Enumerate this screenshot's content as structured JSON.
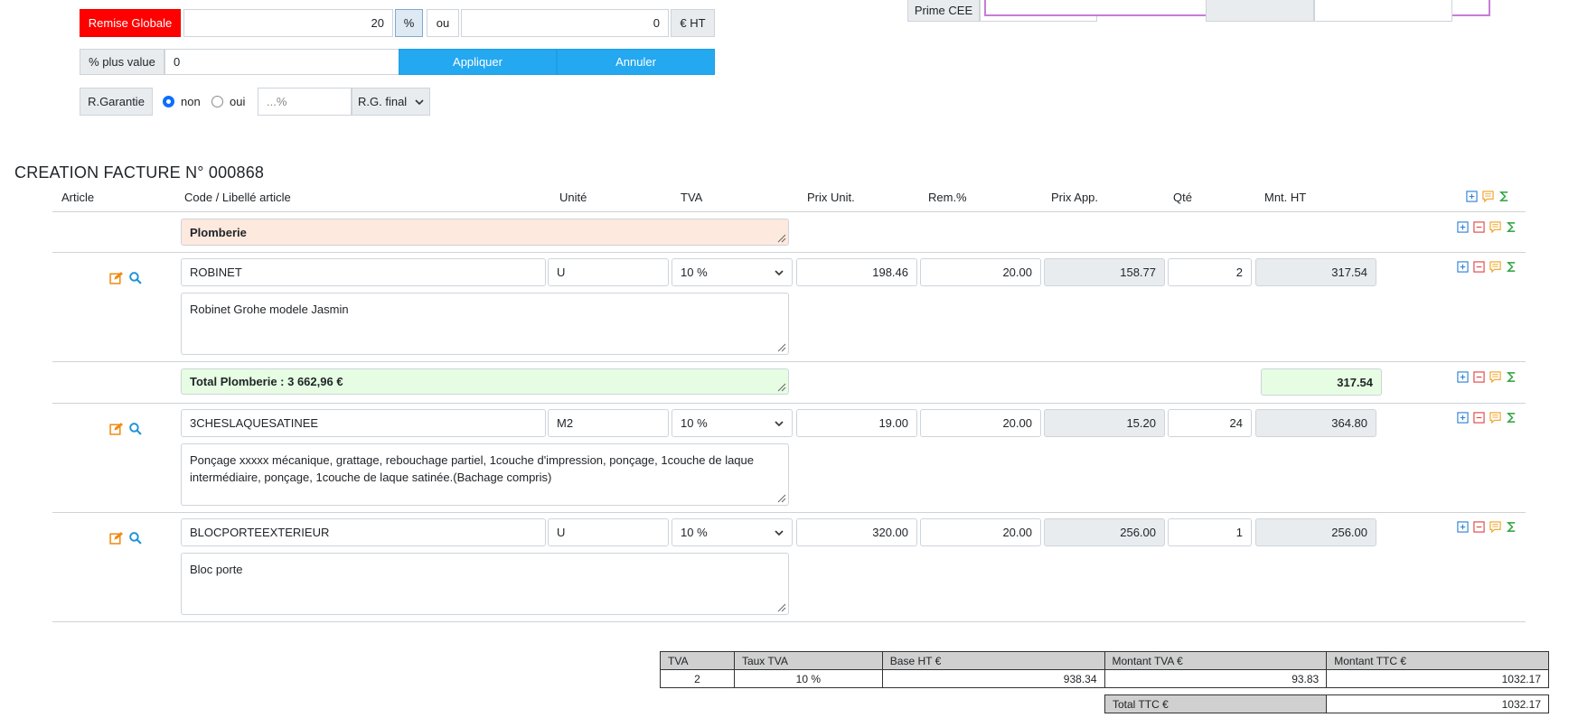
{
  "top": {
    "remise_label": "Remise Globale",
    "remise_value": "20",
    "pct_label": "%",
    "ou_label": "ou",
    "remise_amount": "0",
    "ht_label": "€ HT",
    "plus_value_label": "% plus value",
    "plus_value_value": "0",
    "apply_label": "Appliquer",
    "cancel_label": "Annuler",
    "rg_label": "R.Garantie",
    "rg_non": "non",
    "rg_oui": "oui",
    "rg_placeholder": "...%",
    "rg_select": "R.G. final",
    "prime_label": "Prime CEE"
  },
  "title": "CREATION FACTURE N° 000868",
  "headers": {
    "article": "Article",
    "code": "Code / Libellé article",
    "unite": "Unité",
    "tva": "TVA",
    "prix_unit": "Prix Unit.",
    "rem": "Rem.%",
    "prix_app": "Prix App.",
    "qte": "Qté",
    "mnt_ht": "Mnt. HT"
  },
  "section": {
    "label": "Plomberie"
  },
  "rows": [
    {
      "code": "ROBINET",
      "unite": "U",
      "tva": "10 %",
      "prix_unit": "198.46",
      "rem": "20.00",
      "prix_app": "158.77",
      "qte": "2",
      "mnt_ht": "317.54",
      "description": "Robinet Grohe modele Jasmin"
    },
    {
      "code": "3CHESLAQUESATINEE",
      "unite": "M2",
      "tva": "10 %",
      "prix_unit": "19.00",
      "rem": "20.00",
      "prix_app": "15.20",
      "qte": "24",
      "mnt_ht": "364.80",
      "description": "Ponçage xxxxx mécanique, grattage, rebouchage partiel, 1couche d'impression, ponçage, 1couche de laque intermédiaire, ponçage, 1couche de laque satinée.(Bachage compris)"
    },
    {
      "code": "BLOCPORTEEXTERIEUR",
      "unite": "U",
      "tva": "10 %",
      "prix_unit": "320.00",
      "rem": "20.00",
      "prix_app": "256.00",
      "qte": "1",
      "mnt_ht": "256.00",
      "description": "Bloc porte"
    }
  ],
  "subtotal": {
    "label": "Total Plomberie : 3 662,96 €",
    "value": "317.54"
  },
  "tva_table": {
    "headers": [
      "TVA",
      "Taux TVA",
      "Base HT €",
      "Montant TVA €",
      "Montant TTC €"
    ],
    "row": [
      "2",
      "10 %",
      "938.34",
      "93.83",
      "1032.17"
    ],
    "total_label": "Total TTC €",
    "total_value": "1032.17"
  },
  "colors": {
    "accent": "#24a8f0",
    "danger": "#ff0000",
    "section_bg": "#fde9de",
    "total_bg": "#e6fde3"
  }
}
